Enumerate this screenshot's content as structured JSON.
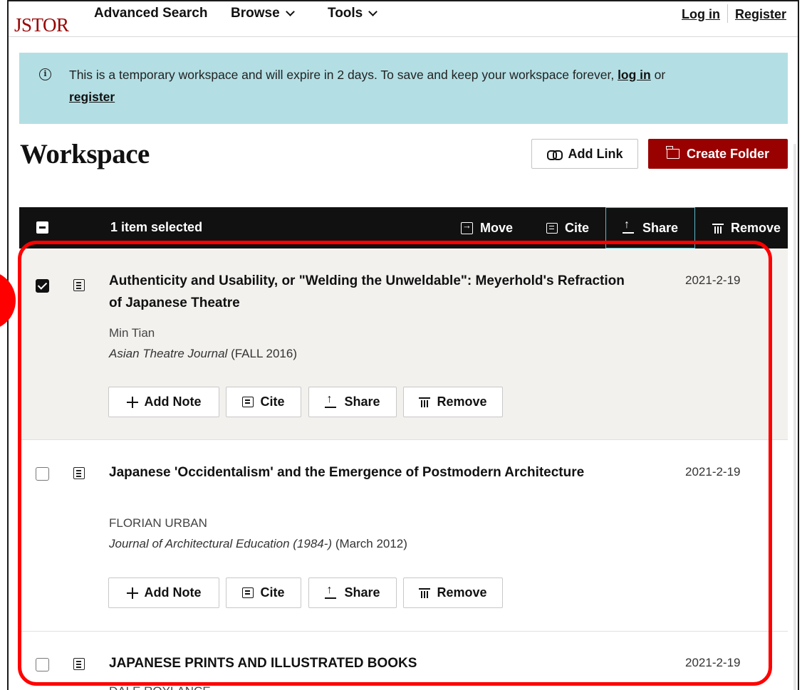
{
  "nav": {
    "logo": "JSTOR",
    "advanced_search": "Advanced Search",
    "browse": "Browse",
    "tools": "Tools",
    "login": "Log in",
    "register": "Register"
  },
  "notice": {
    "text": "This is a temporary workspace and will expire in 2 days. To save and keep your workspace forever,",
    "login_link": "log in",
    "or": "or",
    "register_link": "register"
  },
  "page_title": "Workspace",
  "toolbar": {
    "add_link": "Add Link",
    "create_folder": "Create Folder"
  },
  "selection_bar": {
    "count_text": "1 item selected",
    "move": "Move",
    "cite": "Cite",
    "share": "Share",
    "remove": "Remove"
  },
  "item_actions": {
    "add_note": "Add Note",
    "cite": "Cite",
    "share": "Share",
    "remove": "Remove"
  },
  "items": [
    {
      "title": "Authenticity and Usability, or \"Welding the Unweldable\": Meyerhold's Refraction of Japanese Theatre",
      "date": "2021-2-19",
      "author": "Min Tian",
      "journal": "Asian Theatre Journal",
      "issue": "(FALL 2016)",
      "selected": true
    },
    {
      "title": "Japanese 'Occidentalism' and the Emergence of Postmodern Architecture",
      "date": "2021-2-19",
      "author": "FLORIAN URBAN",
      "journal": "Journal of Architectural Education (1984-)",
      "issue": "(March 2012)",
      "selected": false
    },
    {
      "title": "JAPANESE PRINTS AND ILLUSTRATED BOOKS",
      "date": "2021-2-19",
      "author": "DALE ROYLANCE",
      "selected": false
    }
  ],
  "colors": {
    "brand": "#990000",
    "notice_bg": "#b3dfe4",
    "selection_bar_bg": "#111111",
    "selected_row_bg": "#f2f1ee",
    "annotation": "#ff0000"
  }
}
